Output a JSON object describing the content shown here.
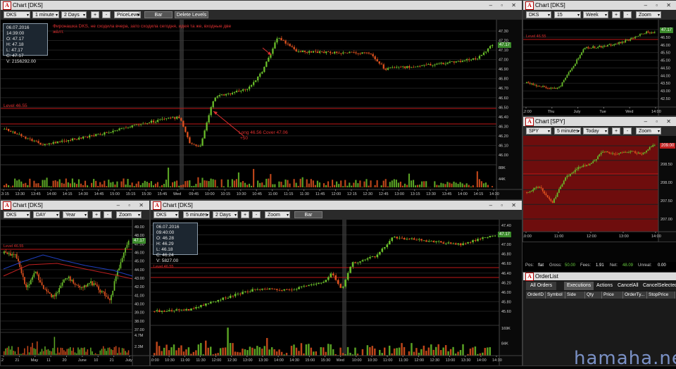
{
  "win1": {
    "title": "Chart [DKS]",
    "symbol": "DKS",
    "interval": "1 minute",
    "range": "2 Days",
    "indicator": "PriceLevel",
    "type_btn": "Bar",
    "delete_btn": "Delete Levels",
    "ohlc": {
      "date": "06.07.2016 14:39:00",
      "o": "O: 47.17",
      "h": "H: 47.18",
      "l": "L: 47.17",
      "c": "C: 47.17",
      "v": "V: 2156292.00"
    },
    "note": "Фиронашка DKS, не сходила вчера, зато сходила сегодня, идея та же, входные две жёлт.",
    "level_label": "Level 46.55",
    "trade_label": "Long 46.56   Cover 47.06",
    "trade_profit": "+50",
    "last_tag": "47.17",
    "y_ticks": [
      "47.30",
      "47.20",
      "47.10",
      "47.00",
      "46.90",
      "46.80",
      "46.70",
      "46.60",
      "46.50",
      "46.40",
      "46.30",
      "46.20",
      "46.10",
      "46.00"
    ],
    "vol_ticks": [
      "88K",
      "44K"
    ],
    "x_ticks": [
      "13:15",
      "13:30",
      "13:45",
      "14:00",
      "14:15",
      "14:30",
      "14:45",
      "15:00",
      "15:15",
      "15:30",
      "15:45",
      "Wed",
      "09:45",
      "10:00",
      "10:15",
      "10:30",
      "10:45",
      "11:00",
      "11:15",
      "11:30",
      "11:45",
      "12:00",
      "12:15",
      "12:30",
      "12:45",
      "13:00",
      "13:15",
      "13:30",
      "13:45",
      "14:00",
      "14:15",
      "14:30"
    ]
  },
  "win2": {
    "title": "Chart [DKS]",
    "symbol": "DKS",
    "interval": "15 minutes",
    "range": "Week",
    "zoom": "Zoom",
    "level_label": "Level 46.55",
    "last_tag": "47.17",
    "y_ticks": [
      "47.00",
      "46.50",
      "46.00",
      "45.50",
      "45.00",
      "44.50",
      "44.00",
      "43.50",
      "43.00",
      "42.50"
    ],
    "x_ticks": [
      "12:00",
      "Thu",
      "July",
      "Tue",
      "Wed",
      "14:00"
    ]
  },
  "win3": {
    "title": "Chart [SPY]",
    "symbol": "SPY",
    "interval": "5 minutes",
    "range": "Today",
    "zoom": "Zoom",
    "last_tag": "209.00",
    "y_ticks": [
      "209.00",
      "208.50",
      "208.00",
      "207.50",
      "207.00"
    ],
    "x_ticks": [
      "10:00",
      "11:00",
      "12:00",
      "13:00",
      "14:00"
    ]
  },
  "win4": {
    "title": "Chart [DKS]",
    "symbol": "DKS",
    "interval": "DAY",
    "range": "Year",
    "zoom": "Zoom",
    "level_label": "Level 46.55",
    "last_tag": "47.17",
    "y_ticks": [
      "49.00",
      "48.00",
      "47.00",
      "46.00",
      "45.00",
      "44.00",
      "43.00",
      "42.00",
      "41.00",
      "40.00",
      "39.00",
      "38.00",
      "37.00"
    ],
    "vol_ticks": [
      "4.7M",
      "2.3M"
    ],
    "x_ticks": [
      "12",
      "21",
      "May",
      "11",
      "20",
      "June",
      "10",
      "21",
      "July"
    ]
  },
  "win5": {
    "title": "Chart [DKS]",
    "symbol": "DKS",
    "interval": "5 minutes",
    "range": "2 Days",
    "zoom": "Zoom",
    "type_btn": "Bar",
    "ohlc": {
      "date": "06.07.2016 09:40:00",
      "o": "O: 46.28",
      "h": "H: 46.29",
      "l": "L: 46.18",
      "c": "C: 46.24",
      "v": "V: 5827.00"
    },
    "level_label": "Level 46.55",
    "last_tag": "47.17",
    "y_ticks": [
      "47.40",
      "47.20",
      "47.00",
      "46.80",
      "46.60",
      "46.40",
      "46.20",
      "46.00",
      "45.80",
      "45.60"
    ],
    "vol_ticks": [
      "169K",
      "84K"
    ],
    "x_ticks": [
      "10:00",
      "10:30",
      "11:00",
      "11:30",
      "12:00",
      "12:30",
      "13:00",
      "13:30",
      "14:00",
      "14:30",
      "15:00",
      "15:30",
      "Wed",
      "10:00",
      "10:30",
      "11:00",
      "11:30",
      "12:00",
      "12:30",
      "13:00",
      "13:30",
      "14:00",
      "14:30"
    ]
  },
  "stats": {
    "pos_label": "Pos:",
    "pos": "flat",
    "gross_label": "Gross:",
    "gross": "50.00",
    "fees_label": "Fees:",
    "fees": "1.91",
    "net_label": "Net:",
    "net": "48.09",
    "unreal_label": "Unreal:",
    "unreal": "0.00"
  },
  "orderlist": {
    "title": "OrderList",
    "tabs": [
      "All Orders",
      "Executions",
      "Actions",
      "CancelAll",
      "CancelSelected"
    ],
    "columns": [
      "OrderID",
      "Symbol",
      "Side",
      "Qty",
      "Price",
      "OrderTy...",
      "StopPrice"
    ]
  },
  "watermark": "hamaha.net",
  "colors": {
    "up": "#6abf2a",
    "down": "#e0521f",
    "level": "#c01818",
    "tag": "#3b8a2b",
    "spy_bg": "#6e0d0d"
  }
}
